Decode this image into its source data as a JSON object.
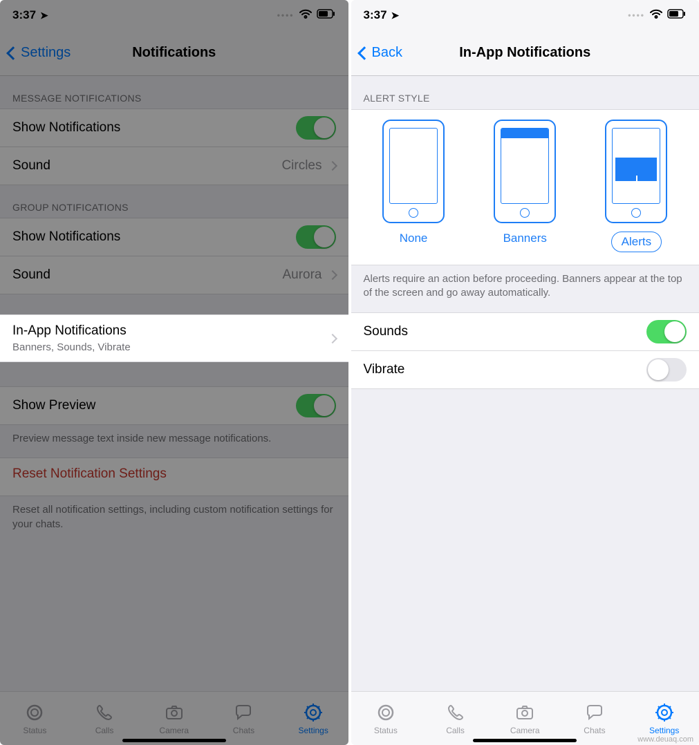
{
  "status": {
    "time": "3:37"
  },
  "left": {
    "back_label": "Settings",
    "title": "Notifications",
    "sections": {
      "message": {
        "header": "MESSAGE NOTIFICATIONS",
        "show_label": "Show Notifications",
        "sound_label": "Sound",
        "sound_value": "Circles"
      },
      "group": {
        "header": "GROUP NOTIFICATIONS",
        "show_label": "Show Notifications",
        "sound_label": "Sound",
        "sound_value": "Aurora"
      },
      "inapp": {
        "title": "In-App Notifications",
        "subtitle": "Banners, Sounds, Vibrate"
      },
      "preview": {
        "label": "Show Preview",
        "footer": "Preview message text inside new message notifications."
      },
      "reset": {
        "label": "Reset Notification Settings",
        "footer": "Reset all notification settings, including custom notification settings for your chats."
      }
    }
  },
  "right": {
    "back_label": "Back",
    "title": "In-App Notifications",
    "alert_header": "ALERT STYLE",
    "alert_options": {
      "none": "None",
      "banners": "Banners",
      "alerts": "Alerts"
    },
    "alert_footer": "Alerts require an action before proceeding. Banners appear at the top of the screen and go away automatically.",
    "sounds_label": "Sounds",
    "vibrate_label": "Vibrate"
  },
  "tabs": {
    "status": "Status",
    "calls": "Calls",
    "camera": "Camera",
    "chats": "Chats",
    "settings": "Settings"
  },
  "watermark": "www.deuaq.com"
}
